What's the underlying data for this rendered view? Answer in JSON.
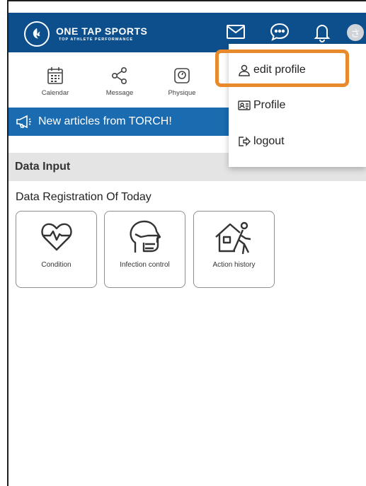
{
  "header": {
    "logo_title": "ONE TAP SPORTS",
    "logo_subtitle": "TOP ATHLETE PERFORMANCE",
    "avatar_initial": "さ"
  },
  "quick_links": [
    {
      "label": "Calendar",
      "icon": "calendar-icon"
    },
    {
      "label": "Message",
      "icon": "share-icon"
    },
    {
      "label": "Physique",
      "icon": "scale-icon"
    }
  ],
  "banner": {
    "text": "New articles from TORCH!",
    "icon": "megaphone-icon"
  },
  "section": {
    "title": "Data Input",
    "subtitle": "Data Registration Of Today"
  },
  "cards": [
    {
      "label": "Condition",
      "icon": "heart-pulse-icon"
    },
    {
      "label": "Infection control",
      "icon": "mask-head-icon"
    },
    {
      "label": "Action history",
      "icon": "house-walker-icon"
    }
  ],
  "dropdown": {
    "items": [
      {
        "label": "edit profile",
        "icon": "user-icon"
      },
      {
        "label": "Profile",
        "icon": "id-card-icon"
      },
      {
        "label": "logout",
        "icon": "logout-icon"
      }
    ]
  },
  "colors": {
    "header": "#0d4f8c",
    "banner": "#1a6bb0",
    "highlight": "#e8892b"
  }
}
